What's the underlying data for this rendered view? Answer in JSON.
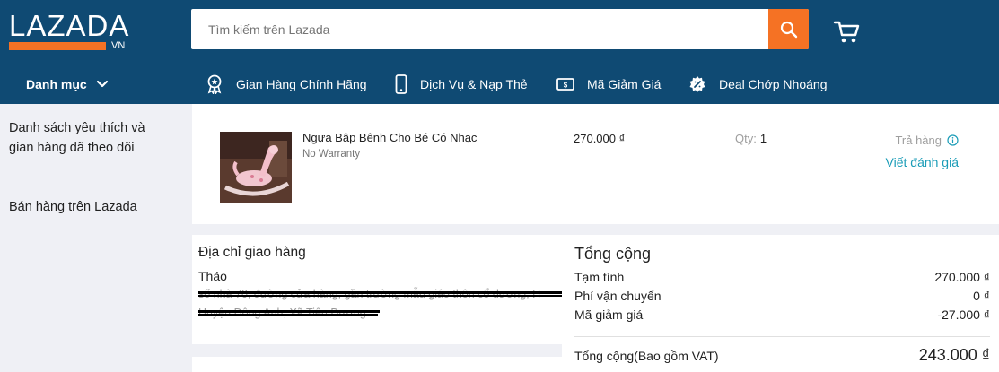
{
  "header": {
    "logo_text": "LAZADA",
    "logo_suffix": ".VN",
    "search_placeholder": "Tìm kiếm trên Lazada",
    "colors": {
      "brand_bg": "#0f4a73",
      "accent": "#f57224",
      "link": "#1a9cb7"
    }
  },
  "nav": {
    "menu_label": "Danh mục",
    "items": [
      {
        "label": "Gian Hàng Chính Hãng",
        "icon": "ribbon-badge-icon"
      },
      {
        "label": "Dịch Vụ & Nạp Thẻ",
        "icon": "phone-icon"
      },
      {
        "label": "Mã Giảm Giá",
        "icon": "voucher-icon"
      },
      {
        "label": "Deal Chớp Nhoáng",
        "icon": "flash-deal-icon"
      }
    ]
  },
  "sidebar": {
    "items": [
      {
        "label": "Danh sách yêu thích và gian hàng đã theo dõi"
      },
      {
        "label": "Bán hàng trên Lazada"
      }
    ]
  },
  "order_item": {
    "name": "Ngựa Bập Bênh Cho Bé Có Nhạc",
    "warranty": "No Warranty",
    "price": "270.000 ₫",
    "qty_label": "Qty:",
    "qty_value": "1",
    "return_label": "Trả hàng",
    "review_label": "Viết đánh giá"
  },
  "address": {
    "title": "Địa chỉ giao hàng",
    "name": "Tháo",
    "line1": "số nhà 70, đường cửa hàng, gần trường mẫu giáo thôn cổ dương, H",
    "line2": "Huyện Đông Anh, Xã Tiên Dương"
  },
  "summary": {
    "title": "Tổng cộng",
    "subtotal_label": "Tạm tính",
    "subtotal_value": "270.000 ₫",
    "shipping_label": "Phí vận chuyển",
    "shipping_value": "0 ₫",
    "discount_label": "Mã giảm giá",
    "discount_value": "-27.000 ₫",
    "total_label": "Tổng cộng(Bao gồm VAT)",
    "total_value": "243.000 ₫"
  }
}
